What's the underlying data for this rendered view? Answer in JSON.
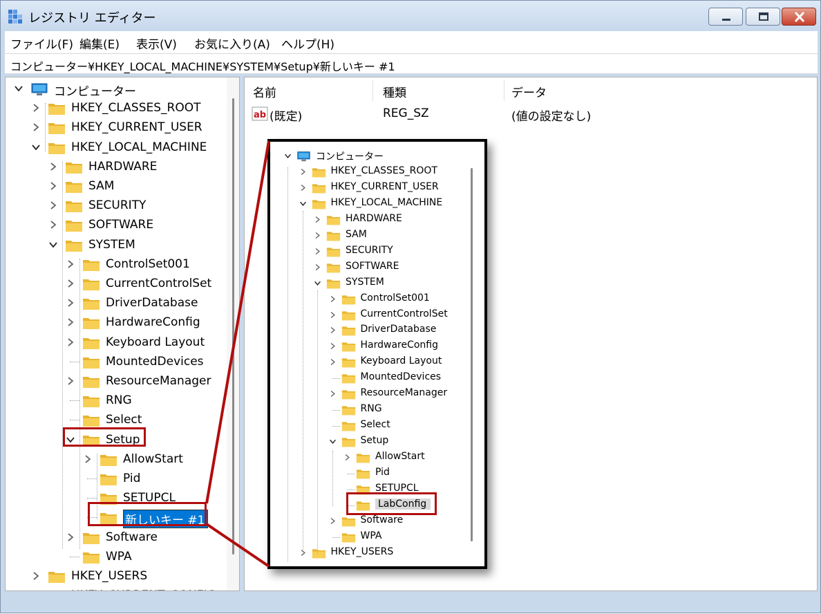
{
  "window": {
    "title": "レジストリ エディター"
  },
  "menu": [
    "ファイル(F)",
    "編集(E)",
    "表示(V)",
    "お気に入り(A)",
    "ヘルプ(H)"
  ],
  "address": "コンピューター¥HKEY_LOCAL_MACHINE¥SYSTEM¥Setup¥新しいキー #1",
  "tree": {
    "root": "コンピューター",
    "nodes": [
      "HKEY_CLASSES_ROOT",
      "HKEY_CURRENT_USER",
      "HKEY_LOCAL_MACHINE",
      "HARDWARE",
      "SAM",
      "SECURITY",
      "SOFTWARE",
      "SYSTEM",
      "ControlSet001",
      "CurrentControlSet",
      "DriverDatabase",
      "HardwareConfig",
      "Keyboard Layout",
      "MountedDevices",
      "ResourceManager",
      "RNG",
      "Select",
      "Setup",
      "AllowStart",
      "Pid",
      "SETUPCL",
      "新しいキー #1",
      "Software",
      "WPA",
      "HKEY_USERS",
      "HKEY_CURRENT_CONFIG"
    ]
  },
  "list": {
    "columns": [
      "名前",
      "種類",
      "データ"
    ],
    "rows": [
      {
        "name": "(既定)",
        "type": "REG_SZ",
        "data": "(値の設定なし)"
      }
    ]
  },
  "zoom": {
    "root": "コンピューター",
    "nodes": [
      "HKEY_CLASSES_ROOT",
      "HKEY_CURRENT_USER",
      "HKEY_LOCAL_MACHINE",
      "HARDWARE",
      "SAM",
      "SECURITY",
      "SOFTWARE",
      "SYSTEM",
      "ControlSet001",
      "CurrentControlSet",
      "DriverDatabase",
      "HardwareConfig",
      "Keyboard Layout",
      "MountedDevices",
      "ResourceManager",
      "RNG",
      "Select",
      "Setup",
      "AllowStart",
      "Pid",
      "SETUPCL",
      "LabConfig",
      "Software",
      "WPA",
      "HKEY_USERS"
    ]
  },
  "colors": {
    "highlight": "#b10d0d",
    "selection": "#0078d7",
    "folder": "#f5c842"
  }
}
